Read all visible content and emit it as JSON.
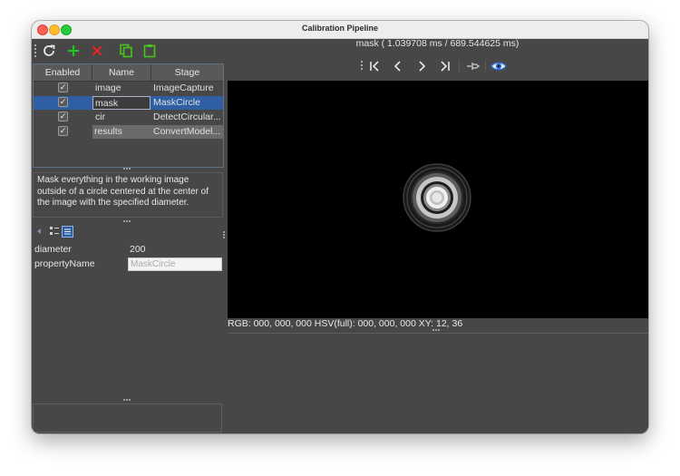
{
  "window": {
    "title": "Calibration Pipeline"
  },
  "toolbar": {
    "icons": [
      "refresh-icon",
      "add-icon",
      "delete-icon",
      "copy-icon",
      "paste-icon"
    ],
    "colors": {
      "add": "#22c31e",
      "delete": "#e0281c",
      "clipboard": "#47c51c"
    }
  },
  "pipeline_table": {
    "headers": [
      "Enabled",
      "Name",
      "Stage"
    ],
    "rows": [
      {
        "enabled": true,
        "name": "image",
        "stage": "ImageCapture"
      },
      {
        "enabled": true,
        "name": "mask",
        "stage": "MaskCircle"
      },
      {
        "enabled": true,
        "name": "cir",
        "stage": "DetectCircular..."
      },
      {
        "enabled": true,
        "name": "results",
        "stage": "ConvertModel..."
      }
    ],
    "selected_row": "mask"
  },
  "description": "Mask everything in the working image outside of a circle centered at the center of the image with the specified diameter.",
  "properties": {
    "rows": [
      {
        "key": "diameter",
        "value": "200"
      },
      {
        "key": "propertyName",
        "value": "MaskCircle"
      }
    ]
  },
  "viewer": {
    "info": "mask ( 1.039708 ms / 689.544625 ms)",
    "status": "RGB: 000, 000, 000 HSV(full): 000, 000, 000 XY: 12, 36",
    "controls": [
      "first-frame-icon",
      "previous-icon",
      "next-icon",
      "last-frame-icon",
      "pin-icon",
      "eye-icon"
    ],
    "accent": "#2f5ea3"
  }
}
